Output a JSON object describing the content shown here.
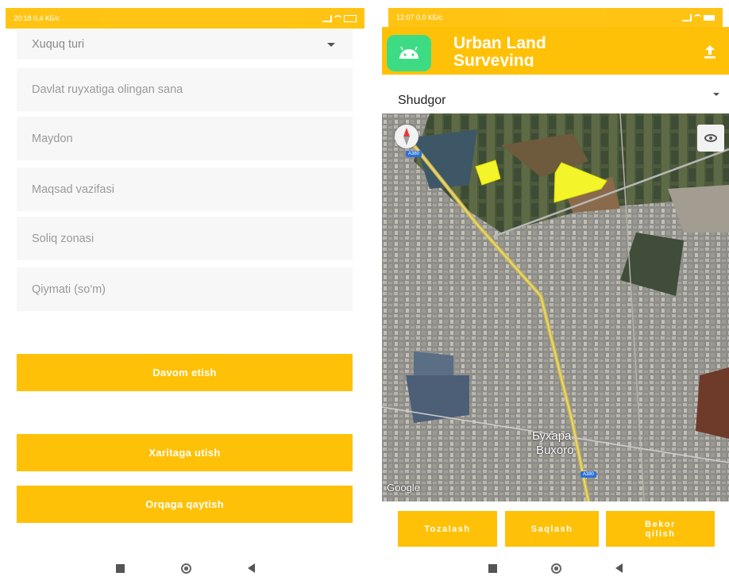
{
  "left_phone": {
    "status": {
      "time": "20:18",
      "speed": "0,4 КБ/с",
      "icons": "signal-wifi-battery"
    },
    "dropdown_value": "Xuquq turi",
    "fields": [
      {
        "placeholder": "Davlat ruyxatiga olingan sana"
      },
      {
        "placeholder": "Maydon"
      },
      {
        "placeholder": "Maqsad vazifasi"
      },
      {
        "placeholder": "Soliq zonasi"
      },
      {
        "placeholder": "Qiymati (so'm)"
      }
    ],
    "buttons": {
      "continue": "Davom etish",
      "to_map": "Xaritaga utish",
      "back": "Orqaga qaytish"
    }
  },
  "right_phone": {
    "status": {
      "time": "12:07",
      "speed": "0,0 КБ/с"
    },
    "app_title_line1": "Urban Land",
    "app_title_line2": "Surveying",
    "dropdown_value": "Shudgor",
    "map": {
      "label_ru": "Бухара",
      "label_uz": "Buxoro",
      "road_badge_top": "A380",
      "road_badge_bottom": "A380",
      "attribution": "Google"
    },
    "buttons": {
      "clear": "Tozalash",
      "save": "Saqlash",
      "cancel_line1": "Bekor",
      "cancel_line2": "qilish"
    }
  },
  "colors": {
    "accent": "#FFC107",
    "polygon": "#F4F42B",
    "field_bg": "#F7F7F7"
  }
}
